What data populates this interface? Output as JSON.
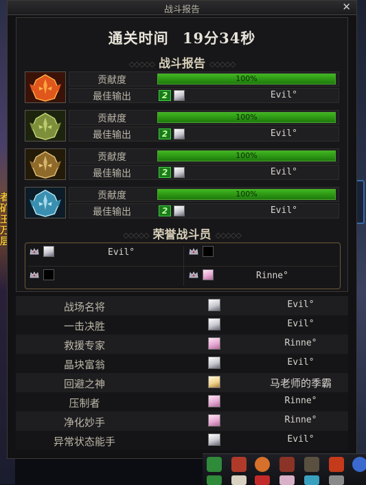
{
  "window": {
    "title": "战斗报告",
    "close_icon": "close-icon"
  },
  "clear_time": {
    "label": "通关时间",
    "value": "19分34秒"
  },
  "battle_report": {
    "header": "战斗报告",
    "rows": [
      {
        "boss_icon": "fire-mask-icon",
        "contribution_label": "贡献度",
        "contribution": "100%",
        "progress": 1.0,
        "best_output_label": "最佳输出",
        "rank": "2",
        "player": "Evil°"
      },
      {
        "boss_icon": "green-mask-icon",
        "contribution_label": "贡献度",
        "contribution": "100%",
        "progress": 1.0,
        "best_output_label": "最佳输出",
        "rank": "2",
        "player": "Evil°"
      },
      {
        "boss_icon": "gold-mask-icon",
        "contribution_label": "贡献度",
        "contribution": "100%",
        "progress": 1.0,
        "best_output_label": "最佳输出",
        "rank": "2",
        "player": "Evil°"
      },
      {
        "boss_icon": "ice-mask-icon",
        "contribution_label": "贡献度",
        "contribution": "100%",
        "progress": 1.0,
        "best_output_label": "最佳输出",
        "rank": "2",
        "player": "Evil°"
      }
    ]
  },
  "honor": {
    "header": "荣誉战斗员",
    "members": [
      {
        "player": "Evil°",
        "avatar": "white"
      },
      {
        "player": "",
        "avatar": "empty"
      },
      {
        "player": "",
        "avatar": "empty"
      },
      {
        "player": "Rinne°",
        "avatar": "pink"
      }
    ]
  },
  "awards": [
    {
      "title": "战场名将",
      "player": "Evil°",
      "avatar": "white"
    },
    {
      "title": "一击决胜",
      "player": "Evil°",
      "avatar": "white"
    },
    {
      "title": "救援专家",
      "player": "Rinne°",
      "avatar": "pink"
    },
    {
      "title": "晶块富翁",
      "player": "Evil°",
      "avatar": "white"
    },
    {
      "title": "回避之神",
      "player": "马老师的季霸",
      "avatar": "blonde"
    },
    {
      "title": "压制者",
      "player": "Rinne°",
      "avatar": "pink"
    },
    {
      "title": "净化妙手",
      "player": "Rinne°",
      "avatar": "pink"
    },
    {
      "title": "异常状态能手",
      "player": "Evil°",
      "avatar": "white"
    }
  ],
  "background_text": "者\n矿\n王\n万\n层",
  "colors": {
    "progress_green": "#3fb61f",
    "frame_gold": "#6e5a36",
    "text_light": "#d9d6cf"
  }
}
